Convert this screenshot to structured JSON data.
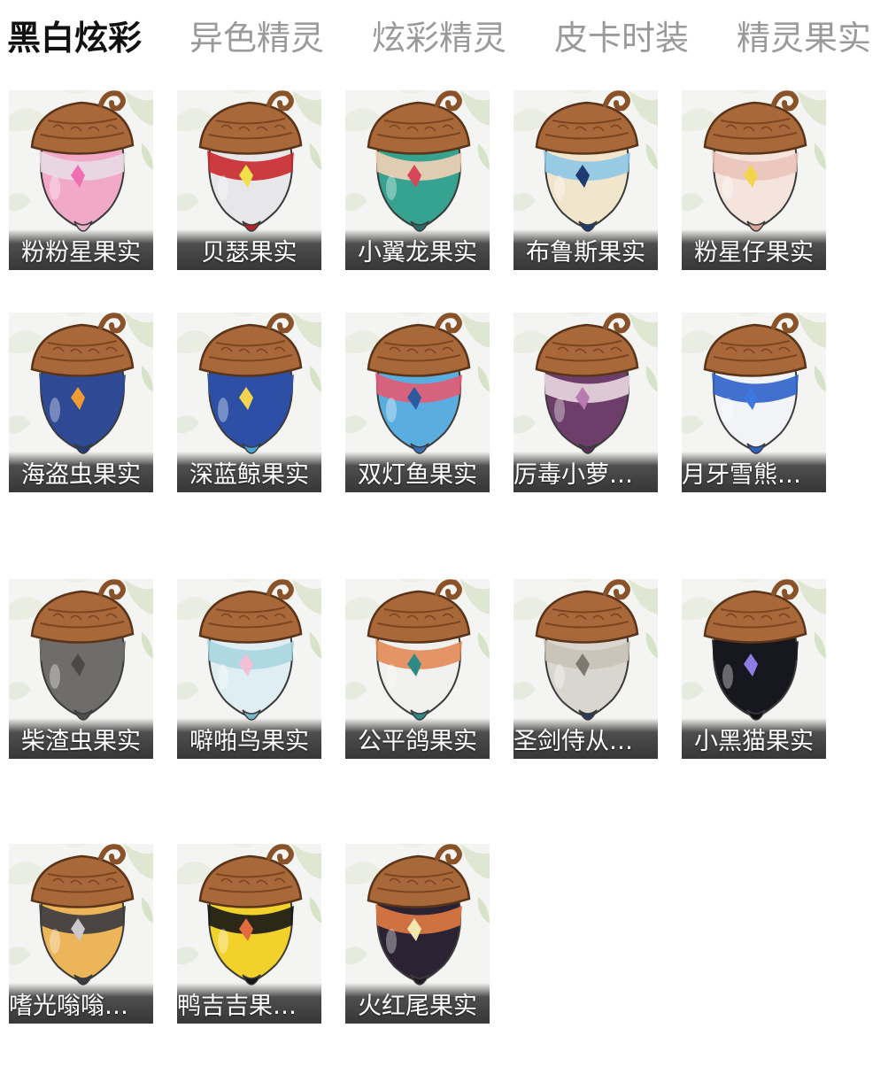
{
  "tabs": [
    {
      "label": "黑白炫彩",
      "active": true
    },
    {
      "label": "异色精灵",
      "active": false
    },
    {
      "label": "炫彩精灵",
      "active": false
    },
    {
      "label": "皮卡时装",
      "active": false
    },
    {
      "label": "精灵果实",
      "active": false
    }
  ],
  "colors": {
    "active_tab": "#111111",
    "inactive_tab": "#9a9a9a",
    "acorn_cap": "#a9683a",
    "label_bar": "#3a3a3a"
  },
  "items": [
    {
      "name": "粉粉星果实",
      "icon": "acorn-pink-star",
      "body": "#f2a9c9",
      "band": "#e7dce6",
      "accent": "#ef6fb0",
      "tip": "#e8b5cd"
    },
    {
      "name": "贝瑟果实",
      "icon": "acorn-red-white",
      "body": "#e7e7ea",
      "band": "#c8282d",
      "accent": "#f2e04a",
      "tip": "#b5232a"
    },
    {
      "name": "小翼龙果实",
      "icon": "acorn-teal",
      "body": "#35a38f",
      "band": "#f3d0b5",
      "accent": "#d6475a",
      "tip": "#2b6b6a"
    },
    {
      "name": "布鲁斯果实",
      "icon": "acorn-blue-cream",
      "body": "#f1e6cc",
      "band": "#8fc7e6",
      "accent": "#1e3b74",
      "tip": "#1e3b74"
    },
    {
      "name": "粉星仔果实",
      "icon": "acorn-peach-star",
      "body": "#f4e4dc",
      "band": "#eac3b9",
      "accent": "#f3d44d",
      "tip": "#d9a69c"
    },
    {
      "name": "海盗虫果实",
      "icon": "acorn-navy-orange",
      "body": "#2f4a95",
      "band": "#2f4a95",
      "accent": "#f09a34",
      "tip": "#243a7a"
    },
    {
      "name": "深蓝鲸果实",
      "icon": "acorn-blue-star",
      "body": "#2d50a6",
      "band": "#2d50a6",
      "accent": "#f3d44d",
      "tip": "#45a6d8"
    },
    {
      "name": "双灯鱼果实",
      "icon": "acorn-sky-stripe",
      "body": "#5aaedf",
      "band": "#e35a73",
      "accent": "#2c5aa0",
      "tip": "#3a6fb6"
    },
    {
      "name": "厉毒小萝…",
      "icon": "acorn-purple-leaf",
      "body": "#6e3e6a",
      "band": "#e9d8e2",
      "accent": "#b87ab0",
      "tip": "#553152"
    },
    {
      "name": "月牙雪熊…",
      "icon": "acorn-white-blue",
      "body": "#f2f3f7",
      "band": "#2e62c9",
      "accent": "#3d77e0",
      "tip": "#2e62c9"
    },
    {
      "name": "柴渣虫果实",
      "icon": "acorn-grey",
      "body": "#6f6d6c",
      "band": "#6f6d6c",
      "accent": "#4b4948",
      "tip": "#504e4d"
    },
    {
      "name": "噼啪鸟果实",
      "icon": "acorn-ice-pink",
      "body": "#dfeef3",
      "band": "#a8d6e0",
      "accent": "#f4c0d8",
      "tip": "#7ab7c6"
    },
    {
      "name": "公平鸽果实",
      "icon": "acorn-white-teal",
      "body": "#f0f0ee",
      "band": "#e28a55",
      "accent": "#2f8a86",
      "tip": "#2f8a86"
    },
    {
      "name": "圣剑侍从…",
      "icon": "acorn-silver-ring",
      "body": "#d9d6cf",
      "band": "#c9c3b6",
      "accent": "#7f7a70",
      "tip": "#2c3a57"
    },
    {
      "name": "小黑猫果实",
      "icon": "acorn-black-purple",
      "body": "#17171f",
      "band": "#17171f",
      "accent": "#8f7de6",
      "tip": "#0f0f16"
    },
    {
      "name": "嗜光嗡嗡…",
      "icon": "acorn-gold-stripe",
      "body": "#ecb55a",
      "band": "#3a3a40",
      "accent": "#c9c9cc",
      "tip": "#3a3a40"
    },
    {
      "name": "鸭吉吉果…",
      "icon": "acorn-yellow-black",
      "body": "#f2d22a",
      "band": "#151515",
      "accent": "#e26a3c",
      "tip": "#151515"
    },
    {
      "name": "火红尾果实",
      "icon": "acorn-swirl",
      "body": "#2b2234",
      "band": "#e27a43",
      "accent": "#f1e8b0",
      "tip": "#1f1a26"
    }
  ]
}
